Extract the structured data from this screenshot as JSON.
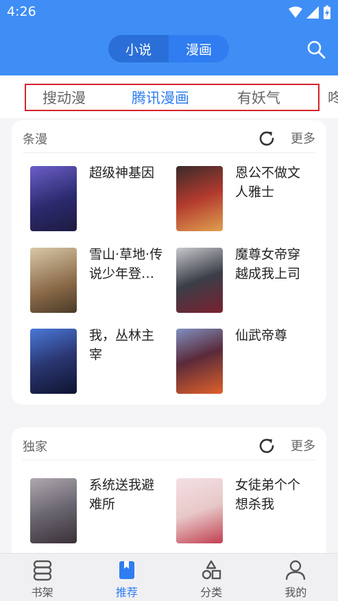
{
  "status": {
    "time": "4:26"
  },
  "header": {
    "segments": [
      {
        "label": "小说"
      },
      {
        "label": "漫画"
      }
    ]
  },
  "tabs": [
    {
      "label": "搜动漫"
    },
    {
      "label": "腾讯漫画"
    },
    {
      "label": "有妖气"
    },
    {
      "label": "咚"
    }
  ],
  "sections": [
    {
      "title": "条漫",
      "more": "更多",
      "books": [
        {
          "title": "超级神基因",
          "cover_color": "#3a3f8a"
        },
        {
          "title": "恩公不做文人雅士",
          "cover_color": "#b23a2e"
        },
        {
          "title": "雪山·草地·传说少年登…",
          "cover_color": "#a89070"
        },
        {
          "title": "魔尊女帝穿越成我上司",
          "cover_color": "#3a3e48"
        },
        {
          "title": "我，丛林主宰",
          "cover_color": "#2a3670"
        },
        {
          "title": "仙武帝尊",
          "cover_color": "#5a2a3a"
        }
      ]
    },
    {
      "title": "独家",
      "more": "更多",
      "books": [
        {
          "title": "系统送我避难所",
          "cover_color": "#6a6670"
        },
        {
          "title": "女徒弟个个想杀我",
          "cover_color": "#e8c8c8"
        }
      ]
    }
  ],
  "nav": [
    {
      "label": "书架",
      "icon": "bookshelf-icon"
    },
    {
      "label": "推荐",
      "icon": "recommend-icon"
    },
    {
      "label": "分类",
      "icon": "category-icon"
    },
    {
      "label": "我的",
      "icon": "profile-icon"
    }
  ]
}
